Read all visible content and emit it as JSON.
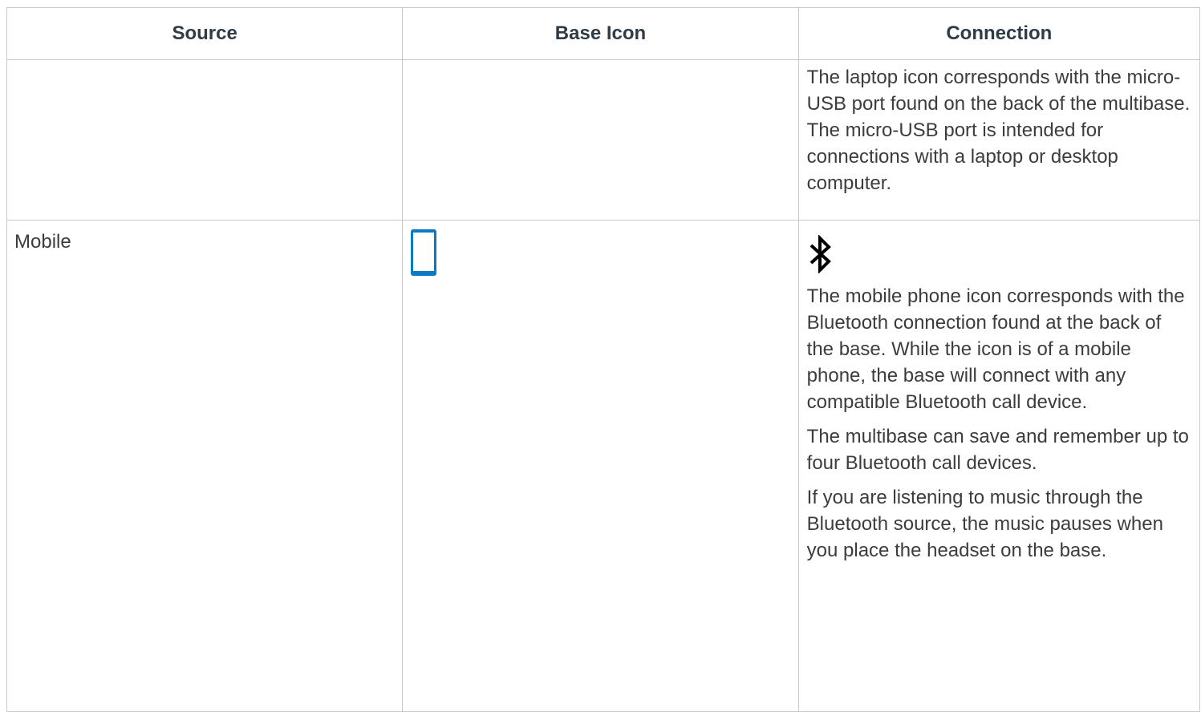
{
  "table": {
    "headers": [
      "Source",
      "Base Icon",
      "Connection"
    ],
    "rows": [
      {
        "source": "",
        "connection_paragraphs": [
          "The laptop icon corresponds with the micro-USB port found on the back of the multibase. The micro-USB port is intended for connections with a laptop or desktop computer."
        ]
      },
      {
        "source": "Mobile",
        "base_icon": "mobile-phone-icon",
        "connection_icon": "bluetooth-icon",
        "connection_paragraphs": [
          "The mobile phone icon corresponds with the Bluetooth connection found at the back of the base. While the icon is of a mobile phone, the base will connect with any compatible Bluetooth call device.",
          "The multibase can save and remember up to four Bluetooth call devices.",
          "If you are listening to music through the Bluetooth source, the music pauses when you place the headset on the base."
        ]
      }
    ]
  },
  "colors": {
    "accent": "#0a7ac4",
    "border": "#c8c8c8",
    "text": "#3c3c3c",
    "header_text": "#2f3b45"
  }
}
